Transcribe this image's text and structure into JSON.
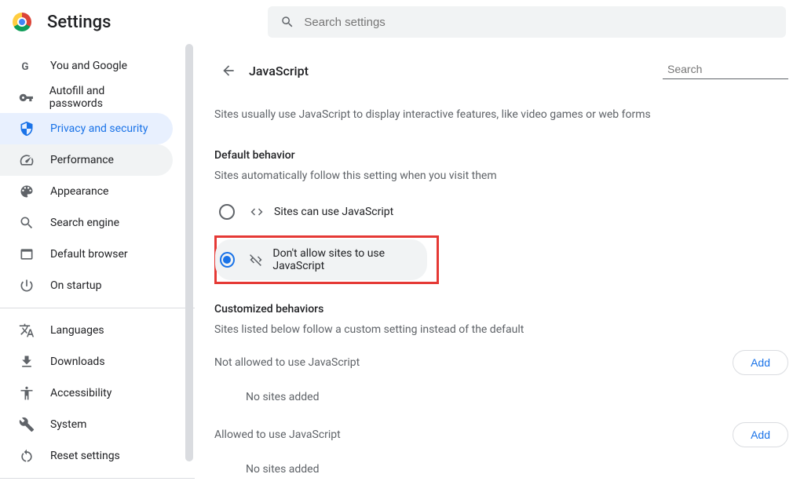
{
  "app_title": "Settings",
  "search": {
    "placeholder": "Search settings"
  },
  "sidebar": {
    "items": [
      {
        "label": "You and Google",
        "icon": "google",
        "active": false
      },
      {
        "label": "Autofill and passwords",
        "icon": "key",
        "active": false
      },
      {
        "label": "Privacy and security",
        "icon": "shield",
        "active": true
      },
      {
        "label": "Performance",
        "icon": "speed",
        "active": false,
        "hover": true
      },
      {
        "label": "Appearance",
        "icon": "palette",
        "active": false
      },
      {
        "label": "Search engine",
        "icon": "search",
        "active": false
      },
      {
        "label": "Default browser",
        "icon": "browser",
        "active": false
      },
      {
        "label": "On startup",
        "icon": "power",
        "active": false
      }
    ],
    "items2": [
      {
        "label": "Languages",
        "icon": "translate"
      },
      {
        "label": "Downloads",
        "icon": "download"
      },
      {
        "label": "Accessibility",
        "icon": "accessibility"
      },
      {
        "label": "System",
        "icon": "system"
      },
      {
        "label": "Reset settings",
        "icon": "reset"
      }
    ]
  },
  "content": {
    "title": "JavaScript",
    "search_placeholder": "Search",
    "description": "Sites usually use JavaScript to display interactive features, like video games or web forms",
    "default_behavior_title": "Default behavior",
    "default_behavior_sub": "Sites automatically follow this setting when you visit them",
    "options": {
      "allow": "Sites can use JavaScript",
      "block": "Don't allow sites to use JavaScript"
    },
    "custom_title": "Customized behaviors",
    "custom_sub": "Sites listed below follow a custom setting instead of the default",
    "not_allowed_label": "Not allowed to use JavaScript",
    "allowed_label": "Allowed to use JavaScript",
    "no_sites": "No sites added",
    "add_button": "Add"
  }
}
